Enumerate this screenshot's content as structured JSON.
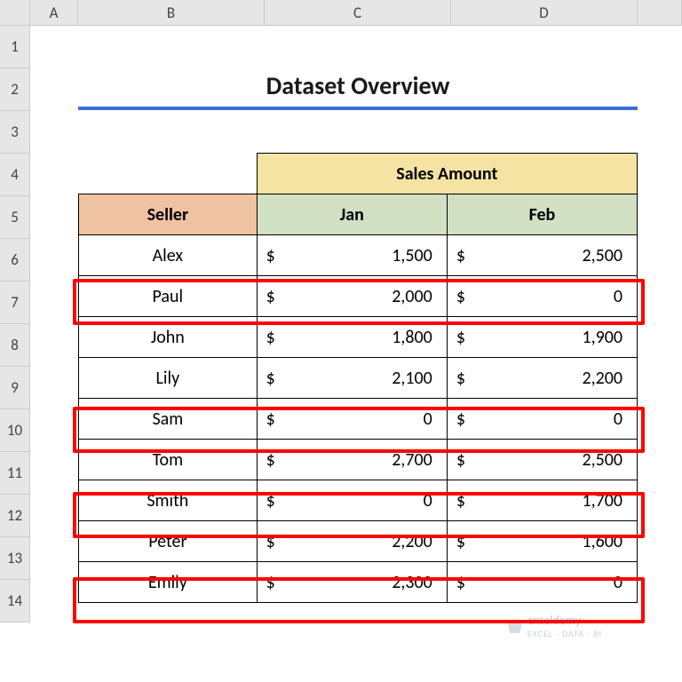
{
  "columns": [
    "A",
    "B",
    "C",
    "D"
  ],
  "row_numbers": [
    "1",
    "2",
    "3",
    "4",
    "5",
    "6",
    "7",
    "8",
    "9",
    "10",
    "11",
    "12",
    "13",
    "14"
  ],
  "title": "Dataset Overview",
  "headers": {
    "sales_amount": "Sales Amount",
    "seller": "Seller",
    "jan": "Jan",
    "feb": "Feb"
  },
  "currency": "$",
  "rows": [
    {
      "seller": "Alex",
      "jan": "1,500",
      "feb": "2,500",
      "hl": false
    },
    {
      "seller": "Paul",
      "jan": "2,000",
      "feb": "0",
      "hl": true
    },
    {
      "seller": "John",
      "jan": "1,800",
      "feb": "1,900",
      "hl": false
    },
    {
      "seller": "Lily",
      "jan": "2,100",
      "feb": "2,200",
      "hl": false
    },
    {
      "seller": "Sam",
      "jan": "0",
      "feb": "0",
      "hl": true
    },
    {
      "seller": "Tom",
      "jan": "2,700",
      "feb": "2,500",
      "hl": false
    },
    {
      "seller": "Smith",
      "jan": "0",
      "feb": "1,700",
      "hl": true
    },
    {
      "seller": "Peter",
      "jan": "2,200",
      "feb": "1,600",
      "hl": false
    },
    {
      "seller": "Emily",
      "jan": "2,300",
      "feb": "0",
      "hl": true
    }
  ],
  "watermark": {
    "brand": "exceldemy",
    "tag": "EXCEL · DATA · BI"
  },
  "chart_data": {
    "type": "table",
    "title": "Dataset Overview",
    "columns": [
      "Seller",
      "Jan",
      "Feb"
    ],
    "series": [
      {
        "name": "Jan",
        "values": [
          1500,
          2000,
          1800,
          2100,
          0,
          2700,
          0,
          2200,
          2300
        ]
      },
      {
        "name": "Feb",
        "values": [
          2500,
          0,
          1900,
          2200,
          0,
          2500,
          1700,
          1600,
          0
        ]
      }
    ],
    "categories": [
      "Alex",
      "Paul",
      "John",
      "Lily",
      "Sam",
      "Tom",
      "Smith",
      "Peter",
      "Emily"
    ],
    "highlighted_rows": [
      "Paul",
      "Sam",
      "Smith",
      "Emily"
    ]
  }
}
